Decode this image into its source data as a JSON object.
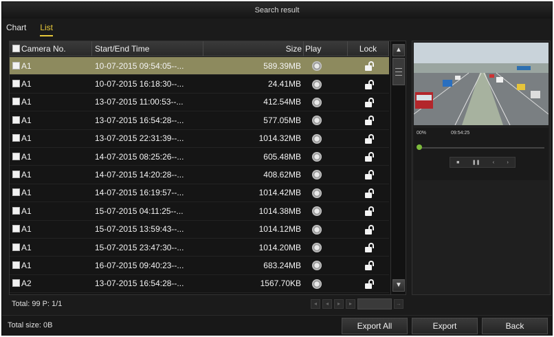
{
  "window": {
    "title": "Search result"
  },
  "tabs": [
    {
      "label": "Chart",
      "active": false
    },
    {
      "label": "List",
      "active": true
    }
  ],
  "table": {
    "columns": [
      "Camera No.",
      "Start/End Time",
      "Size",
      "Play",
      "Lock"
    ],
    "rows": [
      {
        "camera": "A1",
        "time": "10-07-2015 09:54:05--...",
        "size": "589.39MB",
        "selected": true
      },
      {
        "camera": "A1",
        "time": "10-07-2015 16:18:30--...",
        "size": "24.41MB",
        "selected": false
      },
      {
        "camera": "A1",
        "time": "13-07-2015 11:00:53--...",
        "size": "412.54MB",
        "selected": false
      },
      {
        "camera": "A1",
        "time": "13-07-2015 16:54:28--...",
        "size": "577.05MB",
        "selected": false
      },
      {
        "camera": "A1",
        "time": "13-07-2015 22:31:39--...",
        "size": "1014.32MB",
        "selected": false
      },
      {
        "camera": "A1",
        "time": "14-07-2015 08:25:26--...",
        "size": "605.48MB",
        "selected": false
      },
      {
        "camera": "A1",
        "time": "14-07-2015 14:20:28--...",
        "size": "408.62MB",
        "selected": false
      },
      {
        "camera": "A1",
        "time": "14-07-2015 16:19:57--...",
        "size": "1014.42MB",
        "selected": false
      },
      {
        "camera": "A1",
        "time": "15-07-2015 04:11:25--...",
        "size": "1014.38MB",
        "selected": false
      },
      {
        "camera": "A1",
        "time": "15-07-2015 13:59:43--...",
        "size": "1014.12MB",
        "selected": false
      },
      {
        "camera": "A1",
        "time": "15-07-2015 23:47:30--...",
        "size": "1014.20MB",
        "selected": false
      },
      {
        "camera": "A1",
        "time": "16-07-2015 09:40:23--...",
        "size": "683.24MB",
        "selected": false
      },
      {
        "camera": "A2",
        "time": "13-07-2015 16:54:28--...",
        "size": "1567.70KB",
        "selected": false
      }
    ]
  },
  "footer": {
    "total": "Total: 99  P: 1/1"
  },
  "preview": {
    "progress_text": "00%",
    "time_text": "09:54:25"
  },
  "bottom": {
    "total_size": "Total size: 0B",
    "export_all_label": "Export All",
    "export_label": "Export",
    "back_label": "Back"
  },
  "colors": {
    "accent": "#e8c93a",
    "selected_row": "#8d8a5e"
  },
  "icons": [
    "checkbox-icon",
    "play-icon",
    "unlock-icon",
    "scroll-up-icon",
    "scroll-down-icon"
  ]
}
